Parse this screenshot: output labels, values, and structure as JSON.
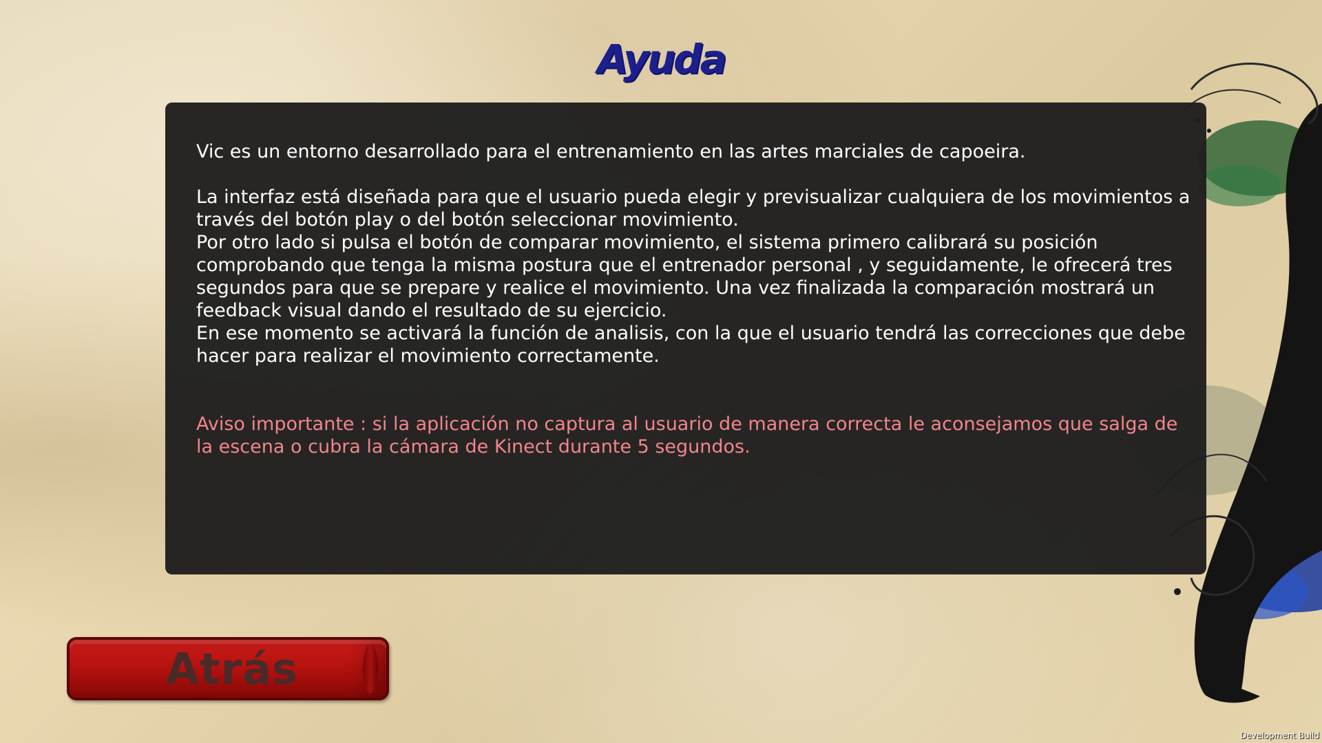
{
  "title": "Ayuda",
  "help": {
    "intro": "Vic es un entorno desarrollado para el entrenamiento en las artes marciales de capoeira.",
    "interface": "La interfaz está diseñada para que el usuario pueda elegir y previsualizar cualquiera de los movimientos a través del botón play o del botón seleccionar movimiento.",
    "compare": "Por otro lado si pulsa el botón de comparar movimiento, el sistema primero calibrará su posición comprobando que tenga la misma postura que el entrenador personal , y seguidamente,  le ofrecerá tres segundos para que se prepare y realice el movimiento. Una vez finalizada la comparación mostrará un feedback visual dando el resultado de su ejercicio.",
    "analysis": "En ese momento se activará la función de analisis, con la que el usuario tendrá las correcciones que debe hacer para realizar el movimiento correctamente.",
    "warning": "Aviso importante : si la aplicación no captura al usuario de manera correcta le aconsejamos que salga de la escena o cubra la cámara de Kinect durante 5 segundos."
  },
  "back_button": {
    "label": "Atrás"
  },
  "footer": {
    "build_label": "Development Build"
  },
  "colors": {
    "title": "#1c1f8c",
    "panel": "#1e1e1e",
    "text": "#ffffff",
    "warning": "#f2858c",
    "button": "#c2160f"
  },
  "icons": {
    "background_art": "capoeira-silhouette-ink-art"
  }
}
